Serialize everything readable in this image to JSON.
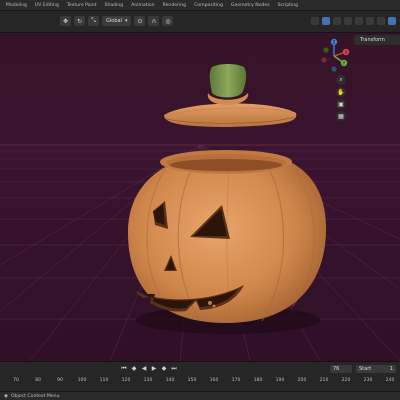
{
  "header": {
    "workspace_tabs": [
      "Modeling",
      "UV Editing",
      "Texture Paint",
      "Shading",
      "Animation",
      "Rendering",
      "Compositing",
      "Geometry Nodes",
      "Scripting"
    ]
  },
  "toolbar": {
    "orientation_label": "Global"
  },
  "viewport": {
    "n_panel_tab": "Transform",
    "gizmo": {
      "x_label": "X",
      "y_label": "Y",
      "z_label": "Z"
    },
    "colors": {
      "background": "#3a1430",
      "grid_line": "#5c2a4f",
      "pumpkin": "#d9894f",
      "stem": "#6f8f46"
    }
  },
  "timeline": {
    "current_frame": "76",
    "start_label": "Start",
    "start_value": "1",
    "ruler_ticks": [
      "70",
      "80",
      "90",
      "100",
      "110",
      "120",
      "130",
      "140",
      "150",
      "160",
      "170",
      "180",
      "190",
      "200",
      "210",
      "220",
      "230",
      "240"
    ]
  },
  "statusbar": {
    "text": "Object Context Menu"
  }
}
